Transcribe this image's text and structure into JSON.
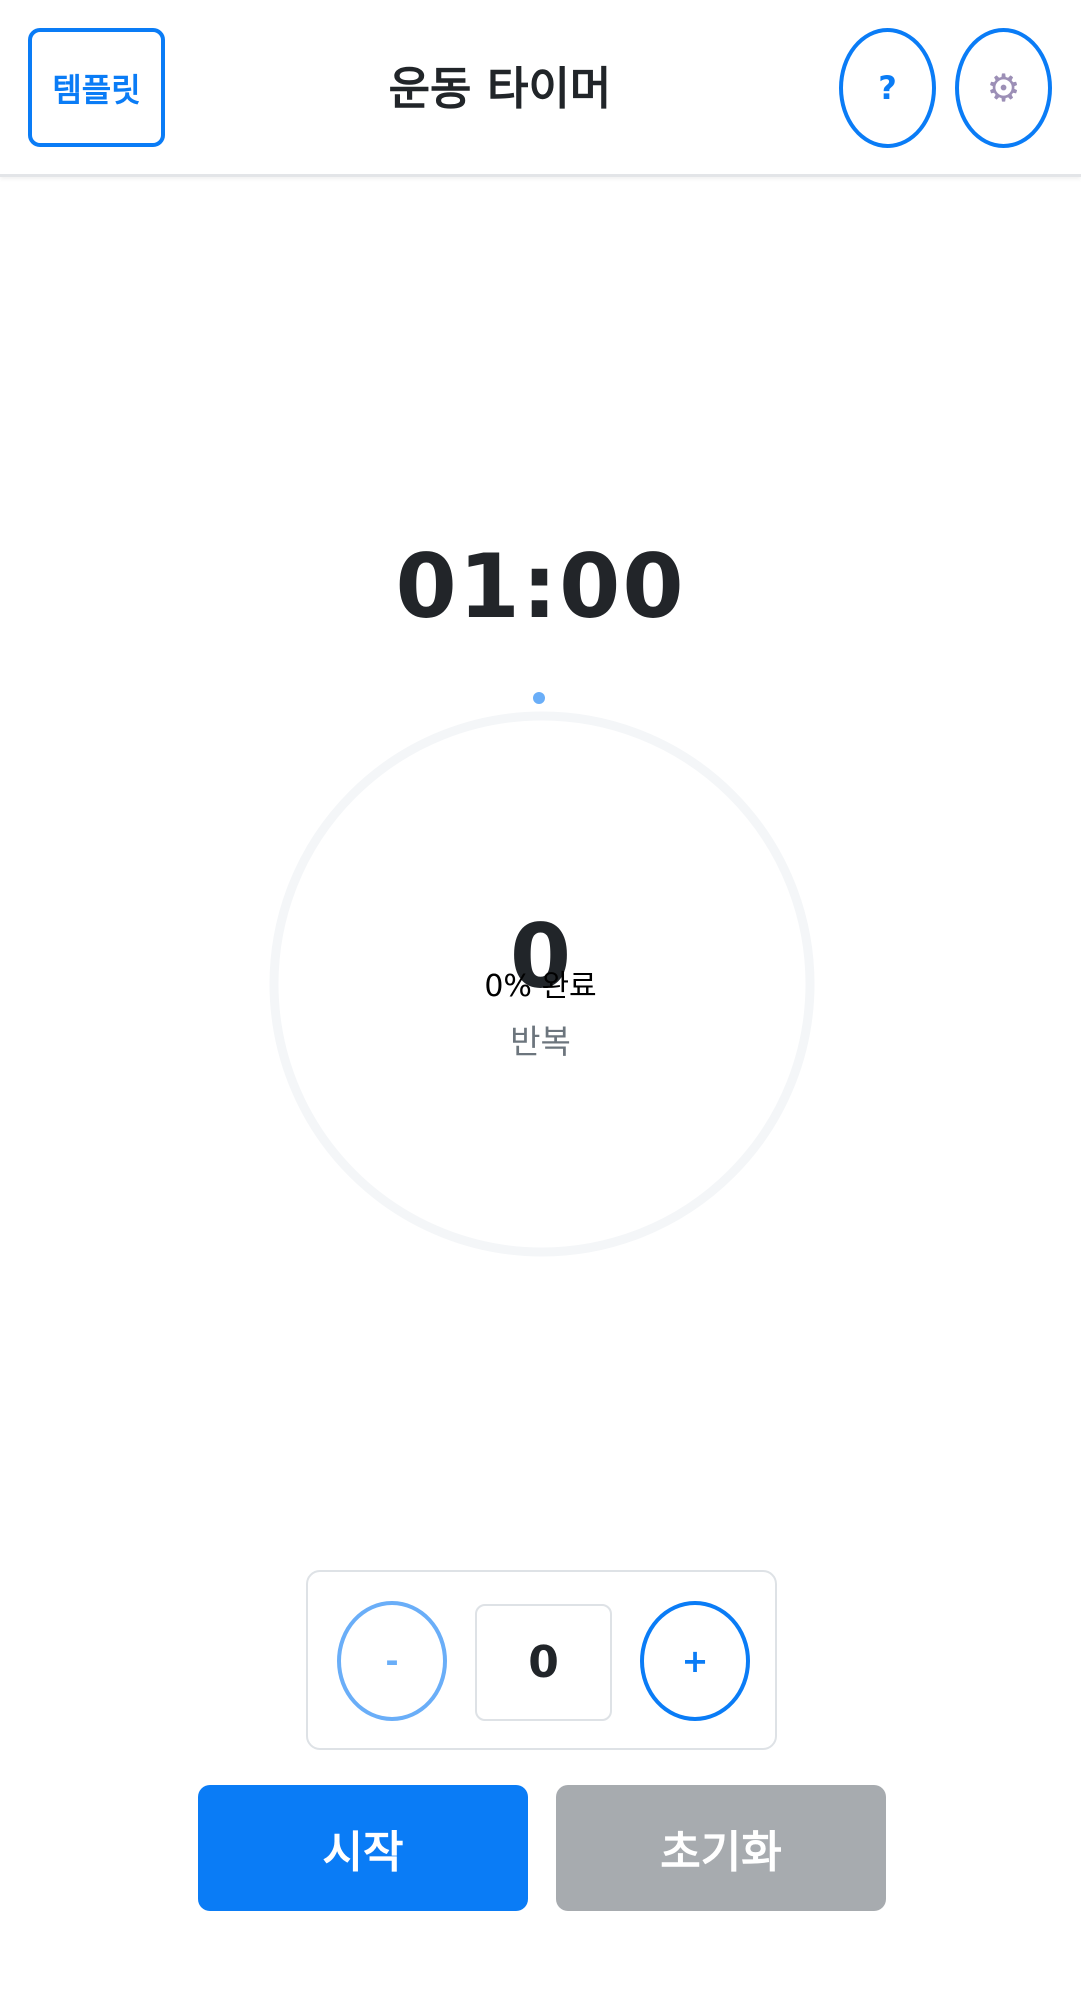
{
  "header": {
    "template_label": "템플릿",
    "title": "운동 타이머",
    "help_label": "?",
    "settings_icon": "gear-icon"
  },
  "timer": {
    "display": "01:00"
  },
  "reps": {
    "count": "0",
    "progress_text": "0% 완료",
    "label": "반복",
    "progress_fraction": 0
  },
  "stepper": {
    "minus_label": "-",
    "value": "0",
    "plus_label": "+"
  },
  "actions": {
    "start_label": "시작",
    "reset_label": "초기화"
  },
  "colors": {
    "accent": "#0a7cf6",
    "accent_light": "#6aaef8",
    "reset_bg": "#a7abaf",
    "ring_track": "#f4f6f8",
    "ring_dot": "#6aaef8"
  }
}
